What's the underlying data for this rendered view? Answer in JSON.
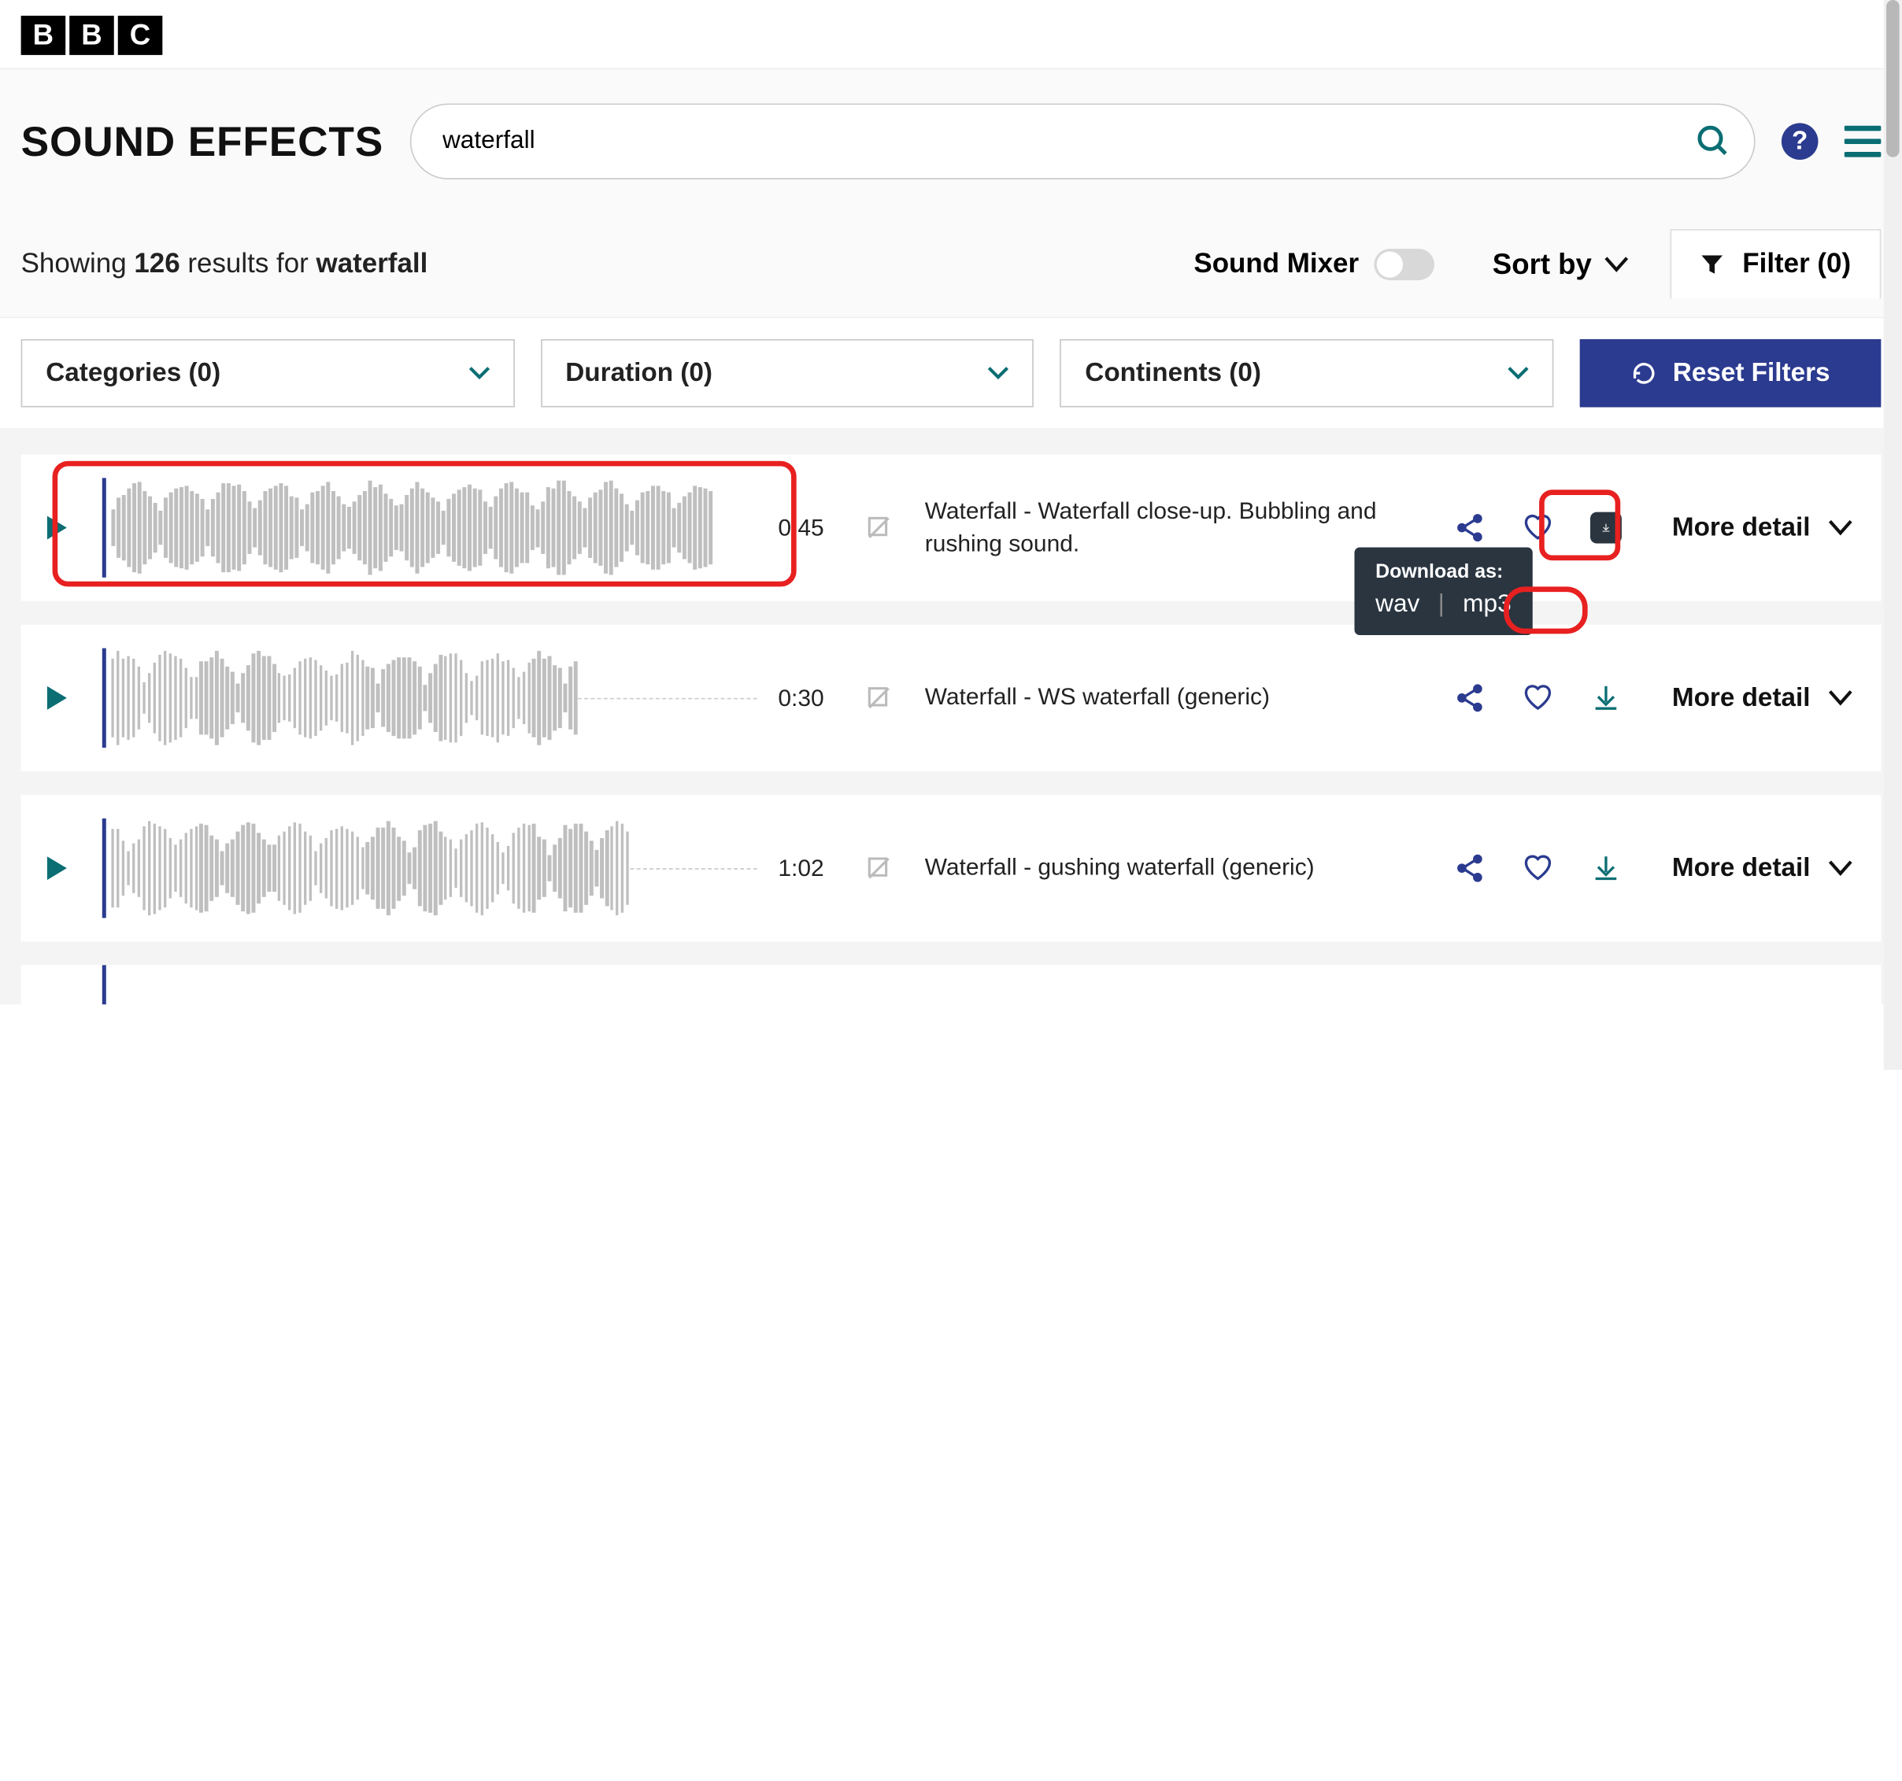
{
  "logo": [
    "B",
    "B",
    "C"
  ],
  "header": {
    "title": "SOUND EFFECTS",
    "search_value": "waterfall"
  },
  "results_summary": {
    "showing": "Showing ",
    "count": "126",
    "middle": " results for ",
    "query": "waterfall"
  },
  "controls": {
    "sound_mixer_label": "Sound Mixer",
    "sort_by_label": "Sort by",
    "filter_label": "Filter (0)"
  },
  "filters": {
    "categories": "Categories (0)",
    "duration": "Duration (0)",
    "continents": "Continents (0)",
    "reset": "Reset Filters"
  },
  "download_popup": {
    "label": "Download as:",
    "wav": "wav",
    "mp3": "mp3"
  },
  "more_detail_label": "More detail",
  "results": [
    {
      "duration": "0:45",
      "description": "Waterfall - Waterfall close-up. Bubbling and rushing sound."
    },
    {
      "duration": "0:30",
      "description": "Waterfall - WS waterfall (generic)"
    },
    {
      "duration": "1:02",
      "description": "Waterfall - gushing waterfall (generic)"
    }
  ]
}
